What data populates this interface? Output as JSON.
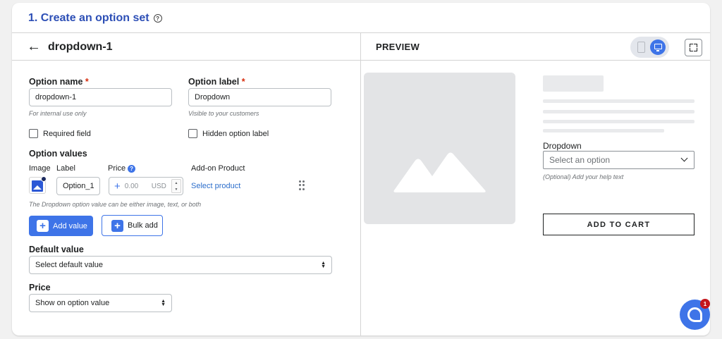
{
  "step": {
    "title": "1. Create an option set",
    "help_icon": "?"
  },
  "editor": {
    "back_icon": "←",
    "title": "dropdown-1",
    "option_name": {
      "label": "Option name",
      "required": "*",
      "value": "dropdown-1",
      "hint": "For internal use only"
    },
    "option_label": {
      "label": "Option label",
      "required": "*",
      "value": "Dropdown",
      "hint": "Visible to your customers"
    },
    "required_field": {
      "label": "Required field",
      "checked": false
    },
    "hidden_label": {
      "label": "Hidden option label",
      "checked": false
    },
    "option_values": {
      "title": "Option values",
      "columns": {
        "image": "Image",
        "label": "Label",
        "price": "Price",
        "price_help": "?",
        "addon": "Add-on Product"
      },
      "rows": [
        {
          "label": "Option_1",
          "price_prefix": "+",
          "price_placeholder": "0.00",
          "currency": "USD",
          "addon_link": "Select product"
        }
      ],
      "hint": "The Dropdown option value can be either image, text, or both"
    },
    "add_value_button": "Add value",
    "bulk_add_button": "Bulk add",
    "plus_symbol": "+",
    "default_value": {
      "label": "Default value",
      "selected": "Select default value"
    },
    "price": {
      "label": "Price",
      "selected": "Show on option value"
    },
    "spinner_up": "▲",
    "spinner_down": "▼"
  },
  "preview": {
    "title": "PREVIEW",
    "device_mode": "desktop",
    "option_label": "Dropdown",
    "select_placeholder": "Select an option",
    "help_text": "(Optional) Add your help text",
    "add_to_cart": "ADD TO CART"
  },
  "chat": {
    "badge_count": "1"
  },
  "colors": {
    "accent": "#3e74e8",
    "title": "#2d4fb6",
    "required": "#d72c0d",
    "link": "#2c6ecb",
    "badge": "#c4161c"
  },
  "icons": [
    "question-circle-icon",
    "back-arrow-icon",
    "mobile-icon",
    "desktop-icon",
    "fullscreen-icon",
    "image-icon",
    "drag-handle-icon",
    "plus-icon",
    "chevron-down-icon",
    "updown-icon",
    "chat-icon",
    "image-placeholder-icon"
  ]
}
